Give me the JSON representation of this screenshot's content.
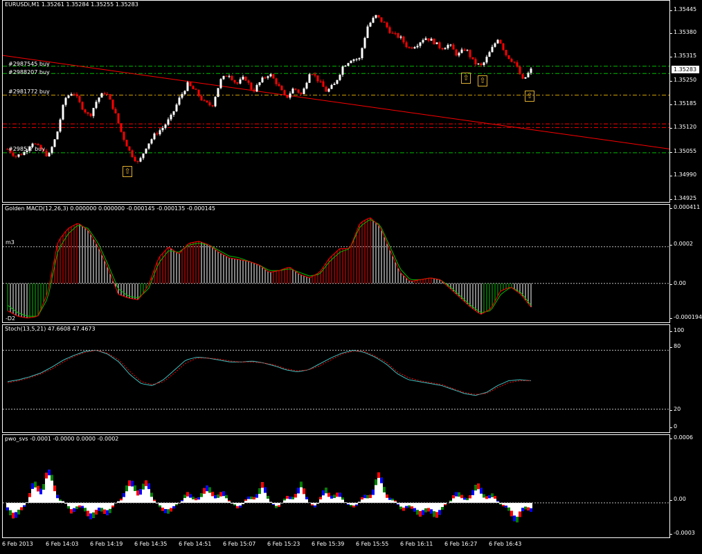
{
  "colors": {
    "bull": "#ffffff",
    "bear": "#ff0000",
    "grid": "#c0c0c0",
    "green_line": "#00c000",
    "red_line": "#ff0000",
    "orange_line": "#d0a000",
    "macd_main": "#ff0000",
    "macd_signal": "#00c000",
    "stoch_main": "#40c0c0",
    "stoch_signal": "#ff0000",
    "pwo_blue": "#0000ff",
    "pwo_green": "#008000",
    "pwo_red": "#ff0000"
  },
  "price_pane": {
    "title": "EURUSDi,M1  1.35261 1.35284 1.35255 1.35283",
    "yticks": [
      "1.35445",
      "1.35380",
      "1.35315",
      "1.35250",
      "1.35185",
      "1.35120",
      "1.35055",
      "1.34990",
      "1.34925"
    ],
    "current_price": "1.35283",
    "orders": [
      {
        "label": "#2987545 buy"
      },
      {
        "label": "#2988207 buy"
      },
      {
        "label": "#2981772 buy"
      },
      {
        "label": "#2985?? buy"
      }
    ],
    "arrow_glyph": "⇧"
  },
  "macd_pane": {
    "title": "Golden MACD(12,26,3) 0.000000 0.000000 -0.000145 -0.000135 -0.000145",
    "yticks": [
      "0.000411",
      "0.0002",
      "0.00",
      "-0.000194"
    ],
    "level_m3": "m3",
    "level_d2": "-D2"
  },
  "stoch_pane": {
    "title": "Stoch(13,5,21) 47.6608 47.4673",
    "yticks": [
      "100",
      "80",
      "20",
      "0"
    ]
  },
  "pwo_pane": {
    "title": "pwo_svs -0.0001 -0.0000 0.0000 -0.0002",
    "yticks": [
      "0.0006",
      "0.00",
      "-0.0003"
    ]
  },
  "xaxis": {
    "labels": [
      "6 Feb 2013",
      "6 Feb 14:03",
      "6 Feb 14:19",
      "6 Feb 14:35",
      "6 Feb 14:51",
      "6 Feb 15:07",
      "6 Feb 15:23",
      "6 Feb 15:39",
      "6 Feb 15:55",
      "6 Feb 16:11",
      "6 Feb 16:27",
      "6 Feb 16:43"
    ]
  },
  "chart_data": [
    {
      "type": "candlestick",
      "title": "EURUSDi,M1",
      "ylim": [
        1.34925,
        1.35445
      ],
      "close_path": [
        1.3506,
        1.3504,
        1.3505,
        1.3508,
        1.3506,
        1.3504,
        1.351,
        1.352,
        1.3522,
        1.3518,
        1.3515,
        1.352,
        1.3522,
        1.3517,
        1.351,
        1.3505,
        1.3502,
        1.3507,
        1.351,
        1.3512,
        1.3515,
        1.352,
        1.3524,
        1.3522,
        1.3519,
        1.3518,
        1.3525,
        1.3527,
        1.3524,
        1.3526,
        1.3522,
        1.3525,
        1.3527,
        1.3524,
        1.352,
        1.3523,
        1.3521,
        1.3528,
        1.3525,
        1.3522,
        1.3524,
        1.3529,
        1.3531,
        1.3531,
        1.354,
        1.3543,
        1.3541,
        1.3538,
        1.3537,
        1.3534,
        1.3535,
        1.3537,
        1.3536,
        1.3534,
        1.3535,
        1.3532,
        1.3534,
        1.353,
        1.3529,
        1.3533,
        1.3537,
        1.3532,
        1.353,
        1.3525,
        1.3528
      ],
      "orders": [
        {
          "name": "#2987545 buy",
          "price": 1.3529
        },
        {
          "name": "#2988207 buy",
          "price": 1.3527
        },
        {
          "name": "#2981772 buy",
          "price": 1.3521
        },
        {
          "name": "buy",
          "price": 1.3505
        }
      ],
      "trendline": {
        "from": 1.3532,
        "to": 1.3506
      }
    },
    {
      "type": "line",
      "title": "Golden MACD(12,26,3)",
      "ylim": [
        -0.000194,
        0.000411
      ],
      "series": [
        {
          "values": [
            -0.00015,
            -0.00018,
            -0.00019,
            -0.00018,
            -5e-05,
            0.00023,
            0.0003,
            0.00033,
            0.00029,
            0.0002,
            8e-05,
            -6e-05,
            -8e-05,
            -9e-05,
            -1e-05,
            0.00014,
            0.0002,
            0.00016,
            0.00022,
            0.00023,
            0.00021,
            0.00017,
            0.00014,
            0.00013,
            0.00012,
            0.0001,
            6e-05,
            7e-05,
            9e-05,
            5e-05,
            3e-05,
            6e-05,
            0.00014,
            0.00019,
            0.00019,
            0.00033,
            0.00036,
            0.00031,
            0.00018,
            6e-05,
            1e-05,
            2e-05,
            3e-05,
            2e-05,
            -3e-05,
            -8e-05,
            -0.00013,
            -0.00017,
            -0.00014,
            -4e-05,
            -2e-05,
            -6e-05,
            -0.00013
          ]
        },
        {
          "values": [
            -0.00012,
            -0.00016,
            -0.00018,
            -0.00018,
            -8e-05,
            0.00018,
            0.00027,
            0.00032,
            0.0003,
            0.00022,
            0.0001,
            -3e-05,
            -7e-05,
            -8e-05,
            -3e-05,
            0.00011,
            0.00018,
            0.00017,
            0.00021,
            0.00022,
            0.00021,
            0.00018,
            0.00015,
            0.00014,
            0.00012,
            0.0001,
            7e-05,
            7e-05,
            8e-05,
            6e-05,
            4e-05,
            5e-05,
            0.00012,
            0.00017,
            0.00019,
            0.00031,
            0.00035,
            0.00032,
            0.0002,
            8e-05,
            2e-05,
            2e-05,
            3e-05,
            2e-05,
            -2e-05,
            -7e-05,
            -0.00012,
            -0.00016,
            -0.00015,
            -6e-05,
            -2e-05,
            -5e-05,
            -0.00012
          ]
        }
      ]
    },
    {
      "type": "line",
      "title": "Stoch(13,5,21)",
      "ylim": [
        0,
        100
      ],
      "series": [
        {
          "values": [
            48,
            50,
            53,
            57,
            63,
            70,
            75,
            79,
            80,
            76,
            68,
            55,
            46,
            44,
            50,
            60,
            70,
            73,
            72,
            70,
            68,
            68,
            69,
            67,
            64,
            60,
            58,
            60,
            66,
            72,
            77,
            80,
            78,
            73,
            66,
            56,
            50,
            48,
            46,
            44,
            40,
            36,
            34,
            37,
            44,
            49,
            50,
            49
          ]
        },
        {
          "values": [
            47,
            49,
            52,
            56,
            61,
            68,
            74,
            78,
            80,
            77,
            70,
            58,
            48,
            45,
            48,
            57,
            67,
            72,
            72,
            71,
            69,
            68,
            68,
            67,
            65,
            61,
            59,
            60,
            64,
            70,
            76,
            79,
            79,
            74,
            68,
            58,
            52,
            49,
            47,
            45,
            41,
            37,
            35,
            36,
            42,
            47,
            49,
            49
          ]
        }
      ]
    },
    {
      "type": "bar",
      "title": "pwo_svs",
      "ylim": [
        -0.0003,
        0.0006
      ],
      "values": [
        -0.0001,
        -0.0002,
        0.0002,
        0.0004,
        0.0001,
        -0.0001,
        -0.0001,
        -0.0002,
        -0.0001,
        0.0001,
        0.0003,
        0.0002,
        -0.0001,
        -0.0001,
        0.0001,
        0.0001,
        0.0002,
        0.0001,
        -0.0001,
        0.0001,
        0.0002,
        -0.0001,
        0.0001,
        0.0002,
        -0.0001,
        0.0002,
        0.0001,
        -0.0001,
        0.0001,
        0.0003,
        0.0001,
        -0.0001,
        -0.0001,
        -0.0002,
        -0.0001,
        0.0001,
        0.0001,
        0.0002,
        0.0001,
        -0.0001,
        -0.0002,
        -0.0001
      ]
    }
  ]
}
